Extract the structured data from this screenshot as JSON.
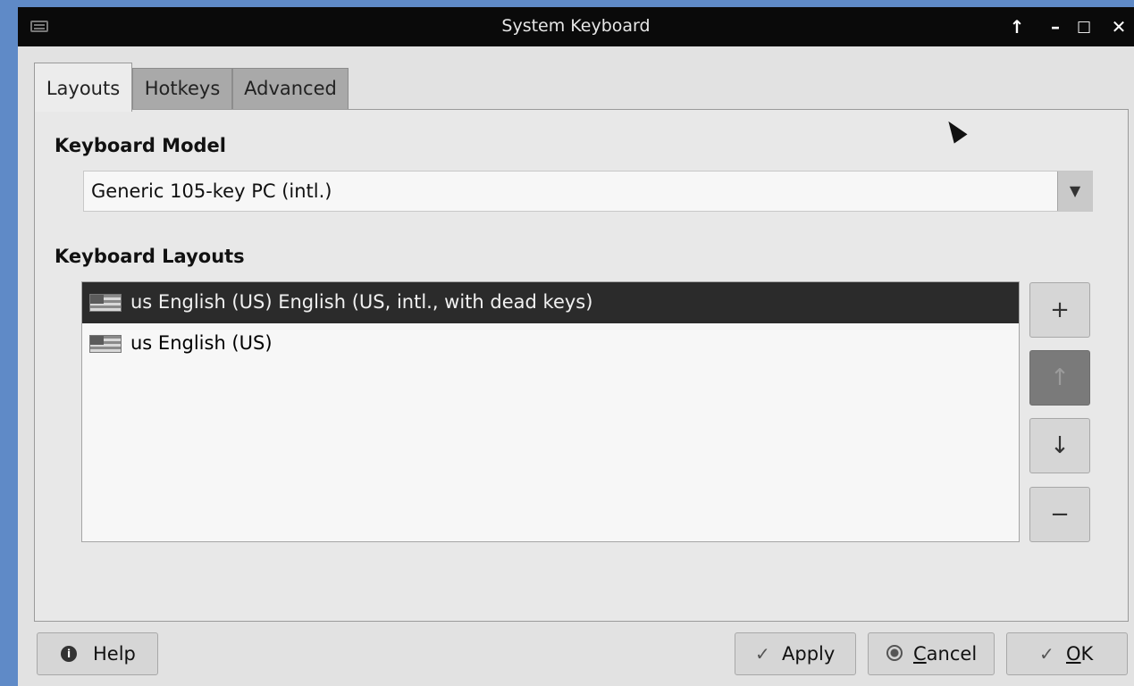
{
  "window": {
    "title": "System Keyboard",
    "controls": {
      "shade": "↑",
      "minimize": "–",
      "maximize": "□",
      "close": "✕"
    }
  },
  "tabs": [
    {
      "label": "Layouts",
      "active": true
    },
    {
      "label": "Hotkeys",
      "active": false
    },
    {
      "label": "Advanced",
      "active": false
    }
  ],
  "keyboard_model": {
    "heading": "Keyboard Model",
    "value": "Generic 105-key PC (intl.)",
    "dropdown_icon": "▼"
  },
  "keyboard_layouts": {
    "heading": "Keyboard Layouts",
    "items": [
      {
        "label": "us English (US) English (US, intl., with dead keys)",
        "selected": true,
        "icon": "us-flag-icon"
      },
      {
        "label": "us English (US)",
        "selected": false,
        "icon": "us-flag-icon"
      }
    ],
    "buttons": {
      "add": "+",
      "move_up": "↑",
      "move_down": "↓",
      "remove": "−"
    }
  },
  "footer": {
    "help": {
      "label": "Help",
      "icon": "info-icon"
    },
    "apply": {
      "label": "Apply",
      "icon": "✓"
    },
    "cancel": {
      "label_first": "C",
      "label_rest": "ancel",
      "icon": "radio-icon"
    },
    "ok": {
      "label_first": "O",
      "label_rest": "K",
      "icon": "✓"
    }
  },
  "colors": {
    "desktop": "#5f8ac7",
    "titlebar": "#0a0a0a",
    "selection": "#2b2b2b"
  }
}
